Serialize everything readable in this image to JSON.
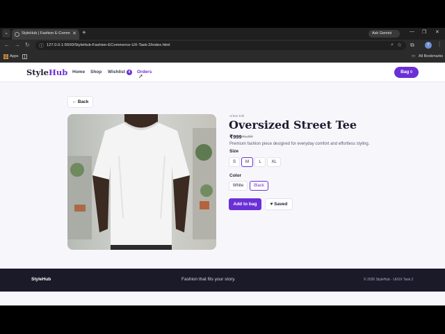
{
  "browser": {
    "tab_title": "StyleHub | Fashion E-Commerce",
    "url": "127.0.0.1:5500/StyleHub-Fashion-ECommerce-UX-Task-2/index.html",
    "gemini_label": "Ask Gemini",
    "profile_initial": "T",
    "bookmarks": {
      "apps": "Apps",
      "all_bookmarks": "All Bookmarks"
    }
  },
  "header": {
    "logo_style": "Style",
    "logo_hub": "Hub",
    "nav": {
      "home": "Home",
      "shop": "Shop",
      "wishlist": "Wishlist",
      "wishlist_count": "4",
      "orders": "Orders"
    },
    "bag_label": "Bag",
    "bag_count": "0"
  },
  "product": {
    "back_label": "← Back",
    "brand": "Urban Edit",
    "title": "Oversized Street Tee",
    "price": "₹999",
    "mrp": "₹1,299",
    "description": "Premium fashion piece designed for everyday comfort and effortless styling.",
    "size_label": "Size",
    "sizes": [
      "S",
      "M",
      "L",
      "XL"
    ],
    "selected_size": "M",
    "color_label": "Color",
    "colors": [
      "White",
      "Black"
    ],
    "selected_color": "Black",
    "add_label": "Add to bag",
    "saved_label": "♥ Saved"
  },
  "footer": {
    "logo": "StyleHub",
    "tagline": "Fashion that fits your story.",
    "copyright": "© 2026 StyleHub · UI/UX Task 2"
  },
  "colors": {
    "accent": "#6b2fd6",
    "footer_bg": "#1b1a29",
    "page_bg": "#f7f6fb"
  }
}
